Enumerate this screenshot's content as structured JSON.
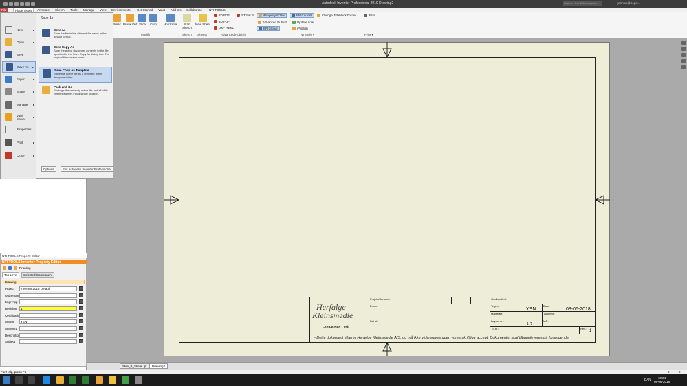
{
  "app": {
    "title": "Autodesk Inventor Professional 2019    Drawing2",
    "search_placeholder": "Search Help & Commands...",
    "user": "yannick@bcgo..."
  },
  "tabs": [
    "File",
    "Place Views",
    "Annotate",
    "Sketch",
    "Tools",
    "Manage",
    "View",
    "Environments",
    "Get Started",
    "Vault",
    "Add-Ins",
    "Collaborate",
    "NTI TOOLS"
  ],
  "ribbon": {
    "modify_buttons": [
      "Break",
      "Break Out",
      "Slice",
      "Crop"
    ],
    "horizontal": "Horizontal",
    "start_sketch": "Start Sketch",
    "new_sheet": "New Sheet",
    "publish_items": [
      "2D PDF",
      "3D PDF",
      "DXF HEKL",
      "STP at P"
    ],
    "nti_items": [
      "iProperty Editor",
      "Advanced Publish",
      "iPublish",
      "BR Current",
      "BR Global",
      "Update now!",
      "Change Titleblock/border"
    ],
    "iprint": "iPrint",
    "groups": [
      "Modify",
      "Sketch",
      "Sheets",
      "Advanced Publish",
      "NTItools ▾",
      "iPrint ▾"
    ]
  },
  "file_menu": {
    "left_items": [
      "New",
      "Open",
      "Save",
      "Save As",
      "Export",
      "Share",
      "Manage",
      "Vault Server",
      "iProperties",
      "Print",
      "Close"
    ],
    "header": "Save As",
    "options": [
      {
        "title": "Save As",
        "desc": "Save the file in the different file name in the default format."
      },
      {
        "title": "Save Copy As",
        "desc": "Save the active document contents to the file specified in the Save Copy As dialog box. The original file remains open."
      },
      {
        "title": "Save Copy As Template",
        "desc": "Save the active file as a template in the template folder."
      },
      {
        "title": "Pack and Go",
        "desc": "Package the currently active file and all of its referenced files into a single location."
      }
    ],
    "options_button": "Options",
    "exit_button": "Exit Autodesk Inventor Professional"
  },
  "nti_panel": {
    "caption": "NTI TOOLS Property Editor",
    "title": "NTI TOOLS Inventor Property Editor",
    "doc_label": "Drawing",
    "tabs": [
      "Top Level",
      "Selected Component"
    ],
    "section": "Drawing",
    "rows": [
      {
        "label": "Project",
        "value": "Inventor 2018 Default"
      },
      {
        "label": "Ordrenummer",
        "value": ""
      },
      {
        "label": "Engr App",
        "value": ""
      },
      {
        "label": "Revision",
        "value": "1"
      },
      {
        "label": "Certification",
        "value": ""
      },
      {
        "label": "Author",
        "value": "YEN"
      },
      {
        "label": "Authority",
        "value": ""
      },
      {
        "label": "Description",
        "value": ""
      },
      {
        "label": "Subject",
        "value": ""
      }
    ]
  },
  "titleblock": {
    "projekt_label": "Projekt/Kartotek:",
    "godkendt_label": "Godkendt af:",
    "emne_label": "Emne:",
    "tegnet_label": "Tegnet:",
    "tegnet_value": "YEN",
    "dato_label": "Dato:",
    "dato_value": "08-06-2018",
    "materiale_label": "Materiale:",
    "tykkelse_label": "Tykkelse:",
    "del_label": "Del af:",
    "layout_label": "Layout nr.:",
    "layout_value": "1 /1",
    "maal_label": "Mål:",
    "tegnr_label": "Tg.nr.:",
    "rev_label": "Rev.:",
    "rev_value": "1",
    "logo_line1": "Herfalge",
    "logo_line2": "Kleinsmedie",
    "slogan": "-en verden i stål...",
    "footer": "- Dette dokument tilhører Herfølge Kleinsmedie A/S, og må ikke videregives uden vores skriftlige accept. Dokumentet skal tilbageleveres på forlangende."
  },
  "sheet_tabs": [
    "Skm_B_Skelet.ipt",
    "Drawing2"
  ],
  "status": {
    "help": "For Help, press F1",
    "n1": "0",
    "n2": "2"
  },
  "taskbar": {
    "lang": "DAN",
    "time": "10:34",
    "date": "08-06-2018"
  }
}
